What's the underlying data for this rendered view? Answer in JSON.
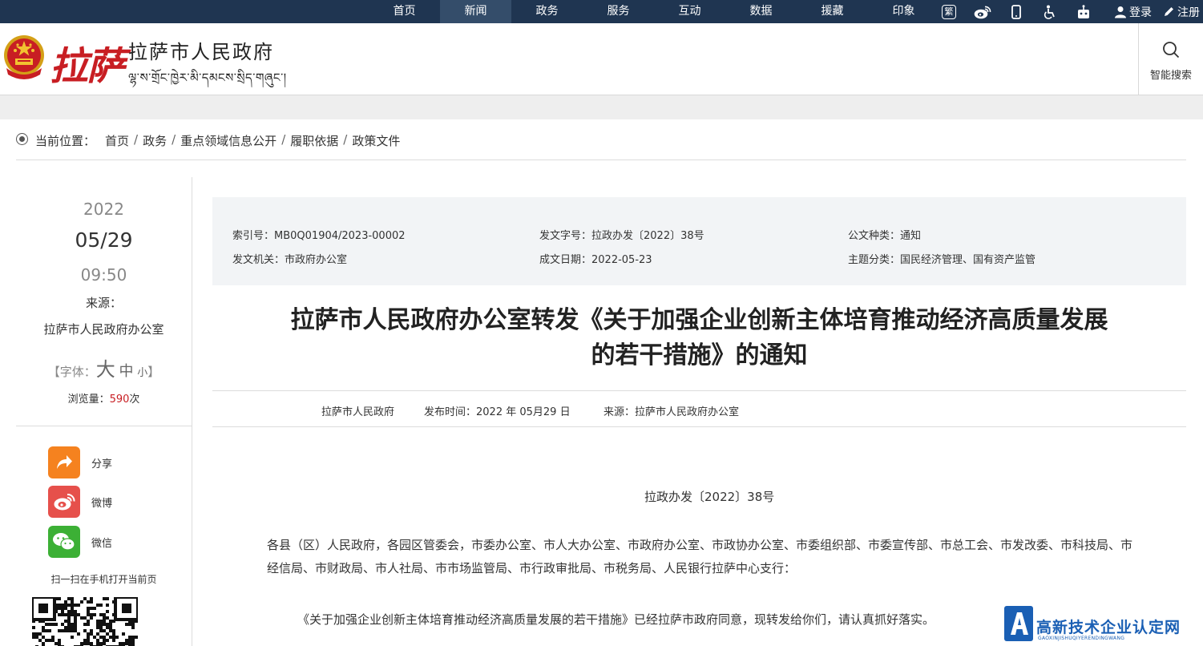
{
  "nav": {
    "items": [
      "首页",
      "新闻",
      "政务",
      "服务",
      "互动",
      "数据",
      "援藏",
      "印象"
    ],
    "icons": [
      "traditional-chinese-icon",
      "weibo-icon",
      "mobile-icon",
      "accessibility-icon",
      "robot-icon"
    ],
    "traditional": "繁",
    "login": "登录",
    "register": "注册"
  },
  "header": {
    "logo_calligraphy": "拉萨",
    "logo_cn": "拉萨市人民政府",
    "logo_tibetan": "ལྷ་ས་གྲོང་ཁྱེར་མི་དམངས་སྲིད་གཞུང་།",
    "search_label": "智能搜索"
  },
  "breadcrumb": {
    "label": "当前位置：",
    "items": [
      "首页",
      "政务",
      "重点领域信息公开",
      "履职依据",
      "政策文件"
    ]
  },
  "sidebar": {
    "year": "2022",
    "date": "05/29",
    "time": "09:50",
    "source_label": "来源：",
    "source": "拉萨市人民政府办公室",
    "font_open": "【字体：",
    "font_big": "大",
    "font_mid": "中",
    "font_small": "小",
    "font_close": "】",
    "views_label": "浏览量：",
    "views": "590",
    "views_unit": "次",
    "share": "分享",
    "weibo": "微博",
    "wechat": "微信",
    "qr_label": "扫一扫在手机打开当前页"
  },
  "info": {
    "index_label": "索引号：",
    "index": "MB0Q01904/2023-00002",
    "docnum_label": "发文字号：",
    "docnum": "拉政办发〔2022〕38号",
    "type_label": "公文种类：",
    "type": "通知",
    "issuer_label": "发文机关：",
    "issuer": "市政府办公室",
    "date_label": "成文日期：",
    "date": "2022-05-23",
    "topic_label": "主题分类：",
    "topic": "国民经济管理、国有资产监管"
  },
  "article": {
    "title_line1": "拉萨市人民政府办公室转发《关于加强企业创新主体培育推动经济高质量发展",
    "title_line2": "的若干措施》的通知",
    "meta_org": "拉萨市人民政府",
    "meta_time_label": "发布时间：",
    "meta_time": "2022 年 05月29 日",
    "meta_source_label": "来源：",
    "meta_source": "拉萨市人民政府办公室",
    "doc_number": "拉政办发〔2022〕38号",
    "addressee": "各县（区）人民政府，各园区管委会，市委办公室、市人大办公室、市政府办公室、市政协办公室、市委组织部、市委宣传部、市总工会、市发改委、市科技局、市经信局、市财政局、市人社局、市市场监管局、市行政审批局、市税务局、人民银行拉萨中心支行：",
    "paragraph": "《关于加强企业创新主体培育推动经济高质量发展的若干措施》已经拉萨市政府同意，现转发给你们，请认真抓好落实。"
  },
  "watermark": {
    "text": "高新技术企业认定网",
    "sub": "GAOXINJISHUQIYERENDINGWANG"
  },
  "colors": {
    "nav_bg": "#1f3551",
    "nav_active": "#344d6a",
    "accent_red": "#c81e23",
    "share_orange": "#f5821f",
    "weibo_red": "#e6504b",
    "wechat_green": "#3cb035"
  }
}
